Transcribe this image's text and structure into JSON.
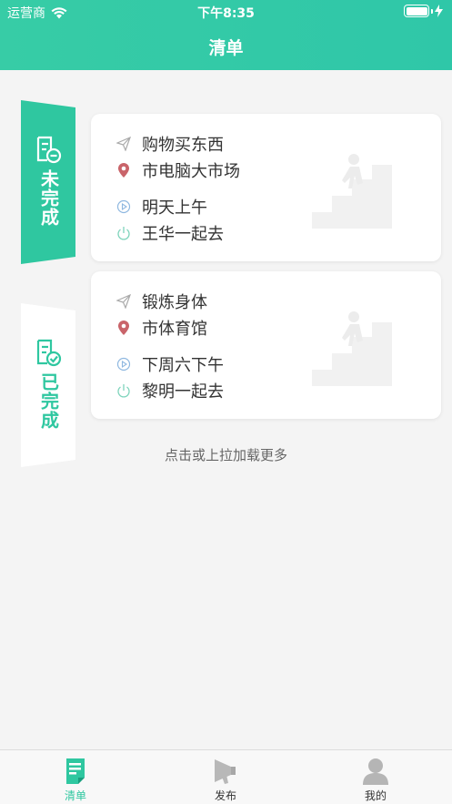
{
  "status_bar": {
    "carrier": "运营商",
    "time": "下午8:35"
  },
  "header": {
    "title": "清单"
  },
  "side_tabs": [
    {
      "label": "未完成",
      "active": true
    },
    {
      "label": "已完成",
      "active": false
    }
  ],
  "cards": [
    {
      "task": "购物买东西",
      "location": "市电脑大市场",
      "time": "明天上午",
      "companion": "王华一起去"
    },
    {
      "task": "锻炼身体",
      "location": "市体育馆",
      "time": "下周六下午",
      "companion": "黎明一起去"
    }
  ],
  "load_more": "点击或上拉加载更多",
  "tabbar": [
    {
      "label": "清单",
      "icon": "list-icon",
      "active": true
    },
    {
      "label": "发布",
      "icon": "megaphone-icon",
      "active": false
    },
    {
      "label": "我的",
      "icon": "user-icon",
      "active": false
    }
  ],
  "colors": {
    "accent": "#2fc7a0",
    "location_pin": "#c9646a"
  }
}
